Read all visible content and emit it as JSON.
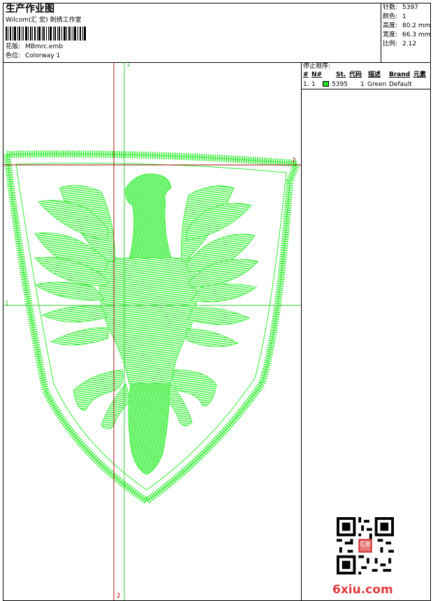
{
  "header": {
    "title": "生产作业图",
    "subtitle": "Wilcom(汇 宏) 刺绣工作室",
    "design_label": "花版:",
    "design_value": "MBmrc.emb",
    "colorway_label": "色位:",
    "colorway_value": "Colorway 1"
  },
  "stats": {
    "stitches_label": "针数:",
    "stitches_value": "5397",
    "colors_label": "颜色:",
    "colors_value": "1",
    "height_label": "高度:",
    "height_value": "80.2 mm",
    "width_label": "宽度:",
    "width_value": "66.3 mm",
    "ratio_label": "比例:",
    "ratio_value": "2.12"
  },
  "stop_sequence": {
    "title": "停止顺序:",
    "columns": [
      "#",
      "N#",
      "St.",
      "代码",
      "描述",
      "Brand",
      "元素"
    ],
    "rows": [
      {
        "num": "1.",
        "needle": "1",
        "stitches": "5395",
        "code": "1",
        "description": "Green",
        "brand": "Default",
        "color": "#22dd22"
      }
    ]
  },
  "guides": {
    "h1_label": "1",
    "v1_label": "1",
    "h2_label": "2",
    "v2_label": "2"
  },
  "colors": {
    "thread": "#33ee33",
    "guide_green": "#33cc33",
    "guide_red": "#aa1111",
    "watermark": "#e03a3e"
  },
  "watermark": "6xiu.com",
  "qr_icon": "qr-code-icon",
  "seal_text": "汇宏"
}
